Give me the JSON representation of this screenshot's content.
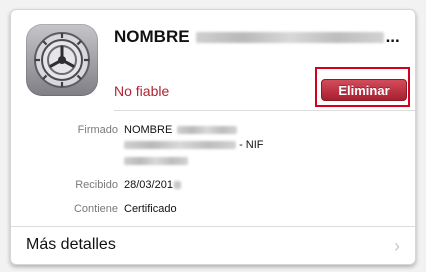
{
  "profile": {
    "title_visible": "NOMBRE",
    "title_suffix": "...",
    "status": "No fiable",
    "delete_label": "Eliminar",
    "icon": "settings-gear-icon"
  },
  "details": {
    "signed_label": "Firmado",
    "signed_name": "NOMBRE",
    "signed_nif": "- NIF",
    "received_label": "Recibido",
    "received_value": "28/03/201",
    "contains_label": "Contiene",
    "contains_value": "Certificado"
  },
  "footer": {
    "more_label": "Más detalles",
    "chevron": "›"
  },
  "colors": {
    "accent_red": "#b02333",
    "highlight": "#d6001c"
  }
}
